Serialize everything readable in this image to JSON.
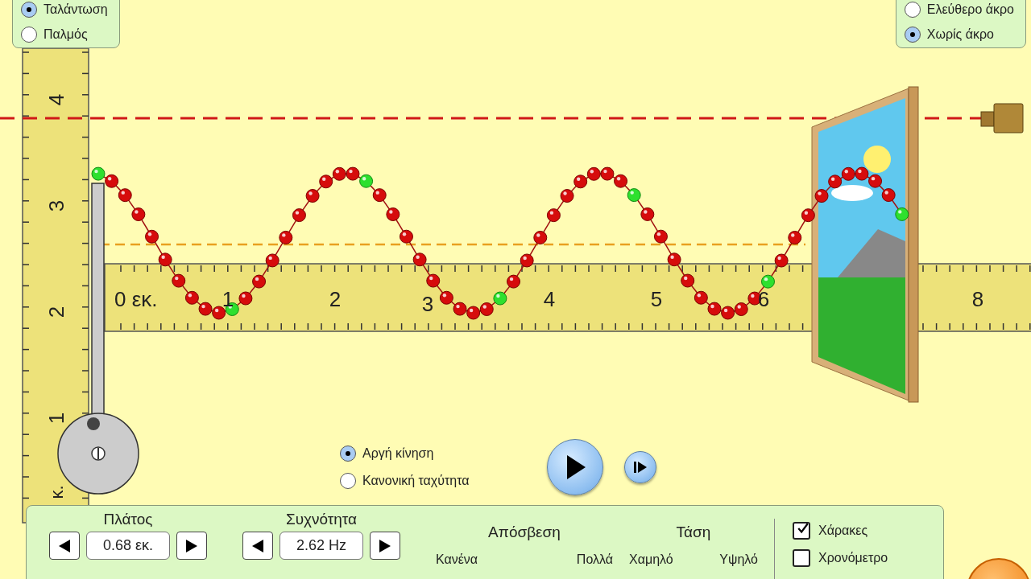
{
  "mode_panel": {
    "options": [
      {
        "label": "Ταλάντωση",
        "selected": true
      },
      {
        "label": "Παλμός",
        "selected": false
      }
    ]
  },
  "end_panel": {
    "options": [
      {
        "label": "Ελεύθερο άκρο",
        "selected": false
      },
      {
        "label": "Χωρίς άκρο",
        "selected": true
      }
    ]
  },
  "vertical_ruler": {
    "labels": [
      "4",
      "3",
      "2",
      "1"
    ],
    "unit": "κ."
  },
  "horizontal_ruler": {
    "labels": [
      "0 εκ.",
      "1",
      "2",
      "3",
      "4",
      "5",
      "6",
      "8"
    ]
  },
  "speed": {
    "options": [
      {
        "label": "Αργή κίνηση",
        "selected": true
      },
      {
        "label": "Κανονική ταχύτητα",
        "selected": false
      }
    ]
  },
  "controls": {
    "amplitude": {
      "label": "Πλάτος",
      "value": "0.68 εκ."
    },
    "frequency": {
      "label": "Συχνότητα",
      "value": "2.62 Hz"
    },
    "damping": {
      "label": "Απόσβεση",
      "min_label": "Κανένα",
      "max_label": "Πολλά"
    },
    "tension": {
      "label": "Τάση",
      "min_label": "Χαμηλό",
      "max_label": "Υψηλό"
    }
  },
  "toggles": [
    {
      "label": "Χάρακες",
      "checked": true
    },
    {
      "label": "Χρονόμετρο",
      "checked": false
    }
  ]
}
